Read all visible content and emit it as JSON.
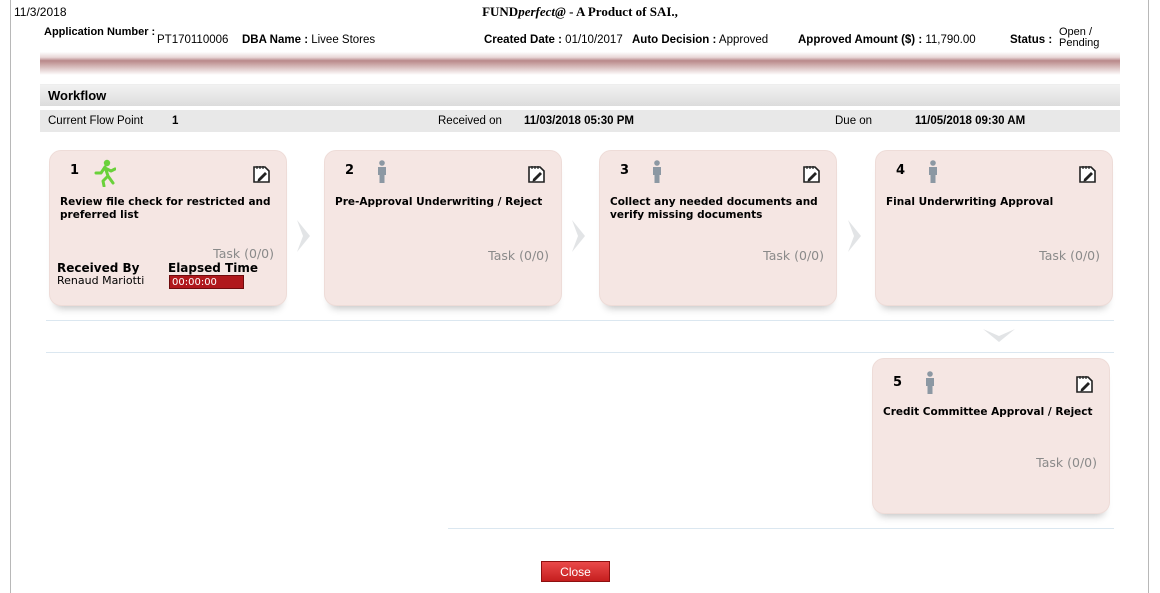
{
  "header": {
    "print_date": "11/3/2018",
    "title_prefix": "FUND",
    "title_italic": "perfect@",
    "title_suffix": " - A Product of SAI.,"
  },
  "application": {
    "number_label": "Application Number :",
    "number_value": "PT170110006",
    "dba_label": "DBA Name :",
    "dba_value": "Livee Stores",
    "created_label": "Created Date :",
    "created_value": "01/10/2017",
    "decision_label": "Auto Decision :",
    "decision_value": "Approved",
    "approved_label": "Approved Amount ($) :",
    "approved_value": "11,790.00",
    "status_label": "Status :",
    "status_value_line1": "Open /",
    "status_value_line2": "Pending"
  },
  "workflow": {
    "title": "Workflow",
    "current_flow_label": "Current Flow Point",
    "current_flow_value": "1",
    "received_label": "Received on",
    "received_value": "11/03/2018 05:30 PM",
    "due_label": "Due on",
    "due_value": "11/05/2018 09:30 AM"
  },
  "steps": [
    {
      "num": "1",
      "name": "Review file check for restricted and preferred list",
      "task": "Task (0/0)",
      "active": true
    },
    {
      "num": "2",
      "name": "Pre-Approval Underwriting / Reject",
      "task": "Task (0/0)",
      "active": false
    },
    {
      "num": "3",
      "name": "Collect any needed documents and verify missing documents",
      "task": "Task (0/0)",
      "active": false
    },
    {
      "num": "4",
      "name": "Final Underwriting Approval",
      "task": "Task (0/0)",
      "active": false
    },
    {
      "num": "5",
      "name": "Credit Committee Approval / Reject",
      "task": "Task (0/0)",
      "active": false
    }
  ],
  "step1_detail": {
    "received_by_label": "Received By",
    "received_by_value": "Renaud Mariotti",
    "elapsed_label": "Elapsed Time",
    "elapsed_value": "00:00:00"
  },
  "icons": {
    "active_person": "running-person-icon",
    "inactive_person": "standing-person-icon",
    "edit": "edit-note-icon",
    "next": "chevron-right-icon",
    "down": "chevron-down-icon"
  },
  "colors": {
    "active_person": "#6ad13a",
    "inactive_person": "#8c98a3",
    "card_bg": "#f5e6e3",
    "elapsed_bg": "#b0181c",
    "close_button": "#d83232"
  },
  "actions": {
    "close_label": "Close"
  }
}
